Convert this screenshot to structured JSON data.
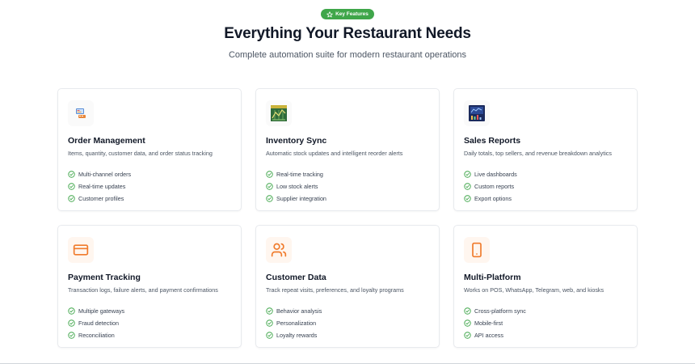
{
  "badge": {
    "label": "Key Features",
    "icon": "star-icon"
  },
  "heading": {
    "title": "Everything Your Restaurant Needs",
    "subtitle": "Complete automation suite for modern restaurant operations"
  },
  "colors": {
    "accent_green": "#3fa64a",
    "icon_orange": "#f07b2c",
    "check_green": "#3fa64a"
  },
  "cards": [
    {
      "title": "Order Management",
      "description": "Items, quantity, customer data, and order status tracking",
      "icon": "order-terminal-icon",
      "features": [
        "Multi-channel orders",
        "Real-time updates",
        "Customer profiles"
      ]
    },
    {
      "title": "Inventory Sync",
      "description": "Automatic stock updates and intelligent reorder alerts",
      "icon": "inventory-chart-icon",
      "features": [
        "Real-time tracking",
        "Low stock alerts",
        "Supplier integration"
      ]
    },
    {
      "title": "Sales Reports",
      "description": "Daily totals, top sellers, and revenue breakdown analytics",
      "icon": "sales-dashboard-icon",
      "features": [
        "Live dashboards",
        "Custom reports",
        "Export options"
      ]
    },
    {
      "title": "Payment Tracking",
      "description": "Transaction logs, failure alerts, and payment confirmations",
      "icon": "credit-card-icon",
      "features": [
        "Multiple gateways",
        "Fraud detection",
        "Reconciliation"
      ]
    },
    {
      "title": "Customer Data",
      "description": "Track repeat visits, preferences, and loyalty programs",
      "icon": "users-icon",
      "features": [
        "Behavior analysis",
        "Personalization",
        "Loyalty rewards"
      ]
    },
    {
      "title": "Multi-Platform",
      "description": "Works on POS, WhatsApp, Telegram, web, and kiosks",
      "icon": "smartphone-icon",
      "features": [
        "Cross-platform sync",
        "Mobile-first",
        "API access"
      ]
    }
  ]
}
